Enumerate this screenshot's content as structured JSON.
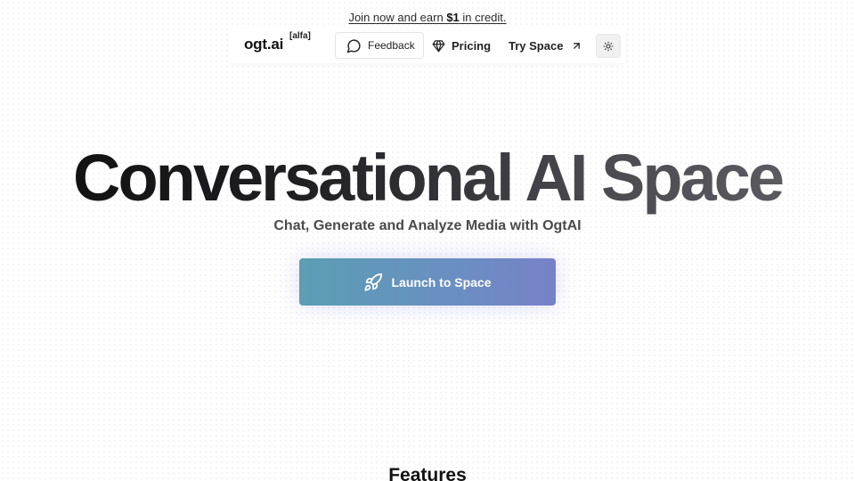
{
  "promo": {
    "prefix": "Join now and earn ",
    "amount": "$1",
    "suffix": " in credit."
  },
  "nav": {
    "brand": "ogt.ai",
    "brand_tag": "[alfa]",
    "feedback_label": "Feedback",
    "pricing_label": "Pricing",
    "try_space_label": "Try Space",
    "icons": {
      "feedback": "chat-bubble-icon",
      "pricing": "diamond-icon",
      "try_space": "arrow-up-right-icon",
      "theme": "sun-icon"
    }
  },
  "hero": {
    "title": "Conversational AI Space",
    "subtitle": "Chat, Generate and Analyze Media with OgtAI",
    "cta_label": "Launch to Space",
    "cta_icon": "rocket-icon"
  },
  "features": {
    "heading": "Features"
  },
  "colors": {
    "cta_start": "#5b9eb3",
    "cta_end": "#7781c8",
    "text_primary": "#111111"
  }
}
